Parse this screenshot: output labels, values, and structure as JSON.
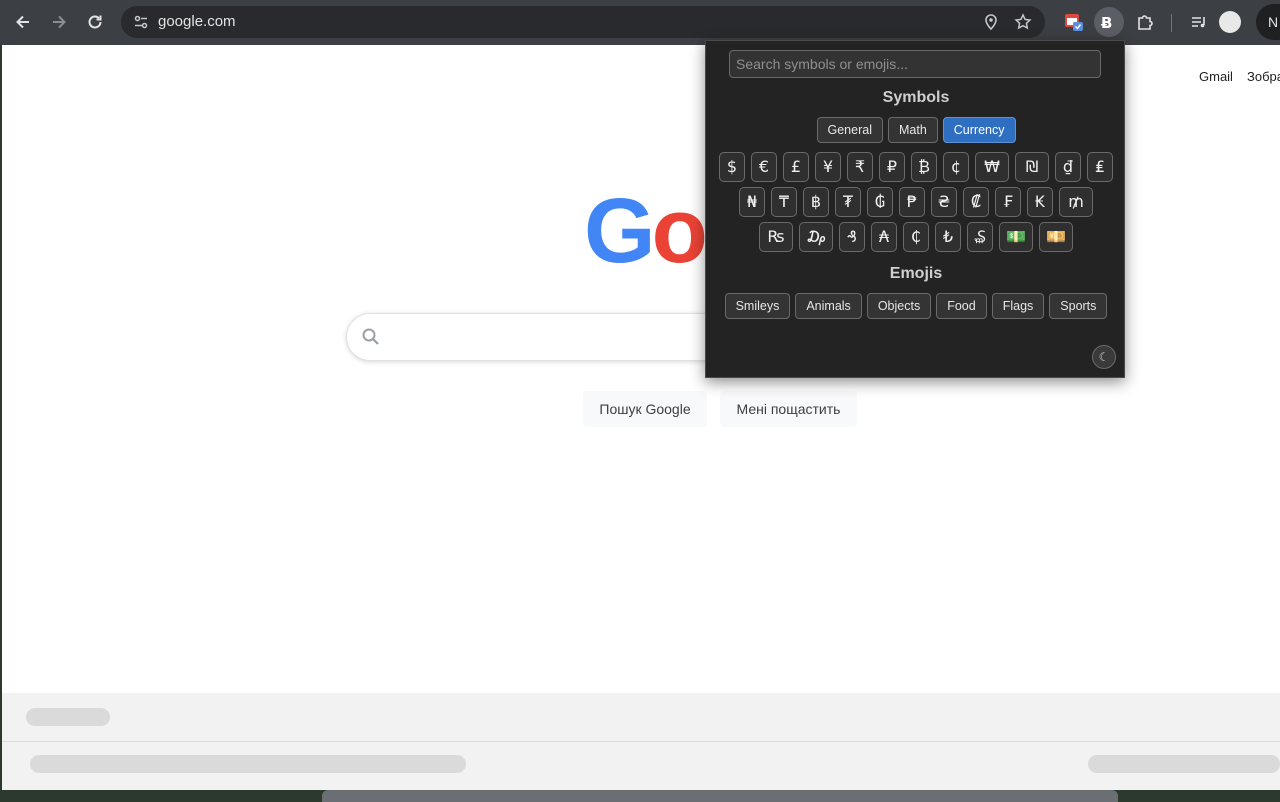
{
  "browser": {
    "url": "google.com",
    "profile_initial": "N"
  },
  "page": {
    "top_links": [
      "Gmail",
      "Зобра"
    ],
    "logo_letters": [
      {
        "char": "G",
        "color": "#4285f4"
      },
      {
        "char": "o",
        "color": "#ea4335"
      }
    ],
    "buttons": {
      "search": "Пошук Google",
      "lucky": "Мені пощастить"
    }
  },
  "popup": {
    "search_placeholder": "Search symbols or emojis...",
    "symbols_title": "Symbols",
    "symbol_tabs": [
      {
        "label": "General",
        "active": false
      },
      {
        "label": "Math",
        "active": false
      },
      {
        "label": "Currency",
        "active": true
      }
    ],
    "symbol_rows": [
      [
        "$",
        "€",
        "£",
        "¥",
        "₹",
        "₽",
        "₿",
        "¢",
        "₩",
        "₪",
        "₫",
        "₤"
      ],
      [
        "₦",
        "₸",
        "฿",
        "₮",
        "₲",
        "₱",
        "₴",
        "₡",
        "₣",
        "₭",
        "₥"
      ],
      [
        "₨",
        "₯",
        "₰",
        "₳",
        "₵",
        "₺",
        "₷",
        "💵",
        "💴"
      ]
    ],
    "emojis_title": "Emojis",
    "emoji_tabs": [
      "Smileys",
      "Animals",
      "Objects",
      "Food",
      "Flags",
      "Sports"
    ],
    "theme_toggle_symbol": "☾"
  }
}
